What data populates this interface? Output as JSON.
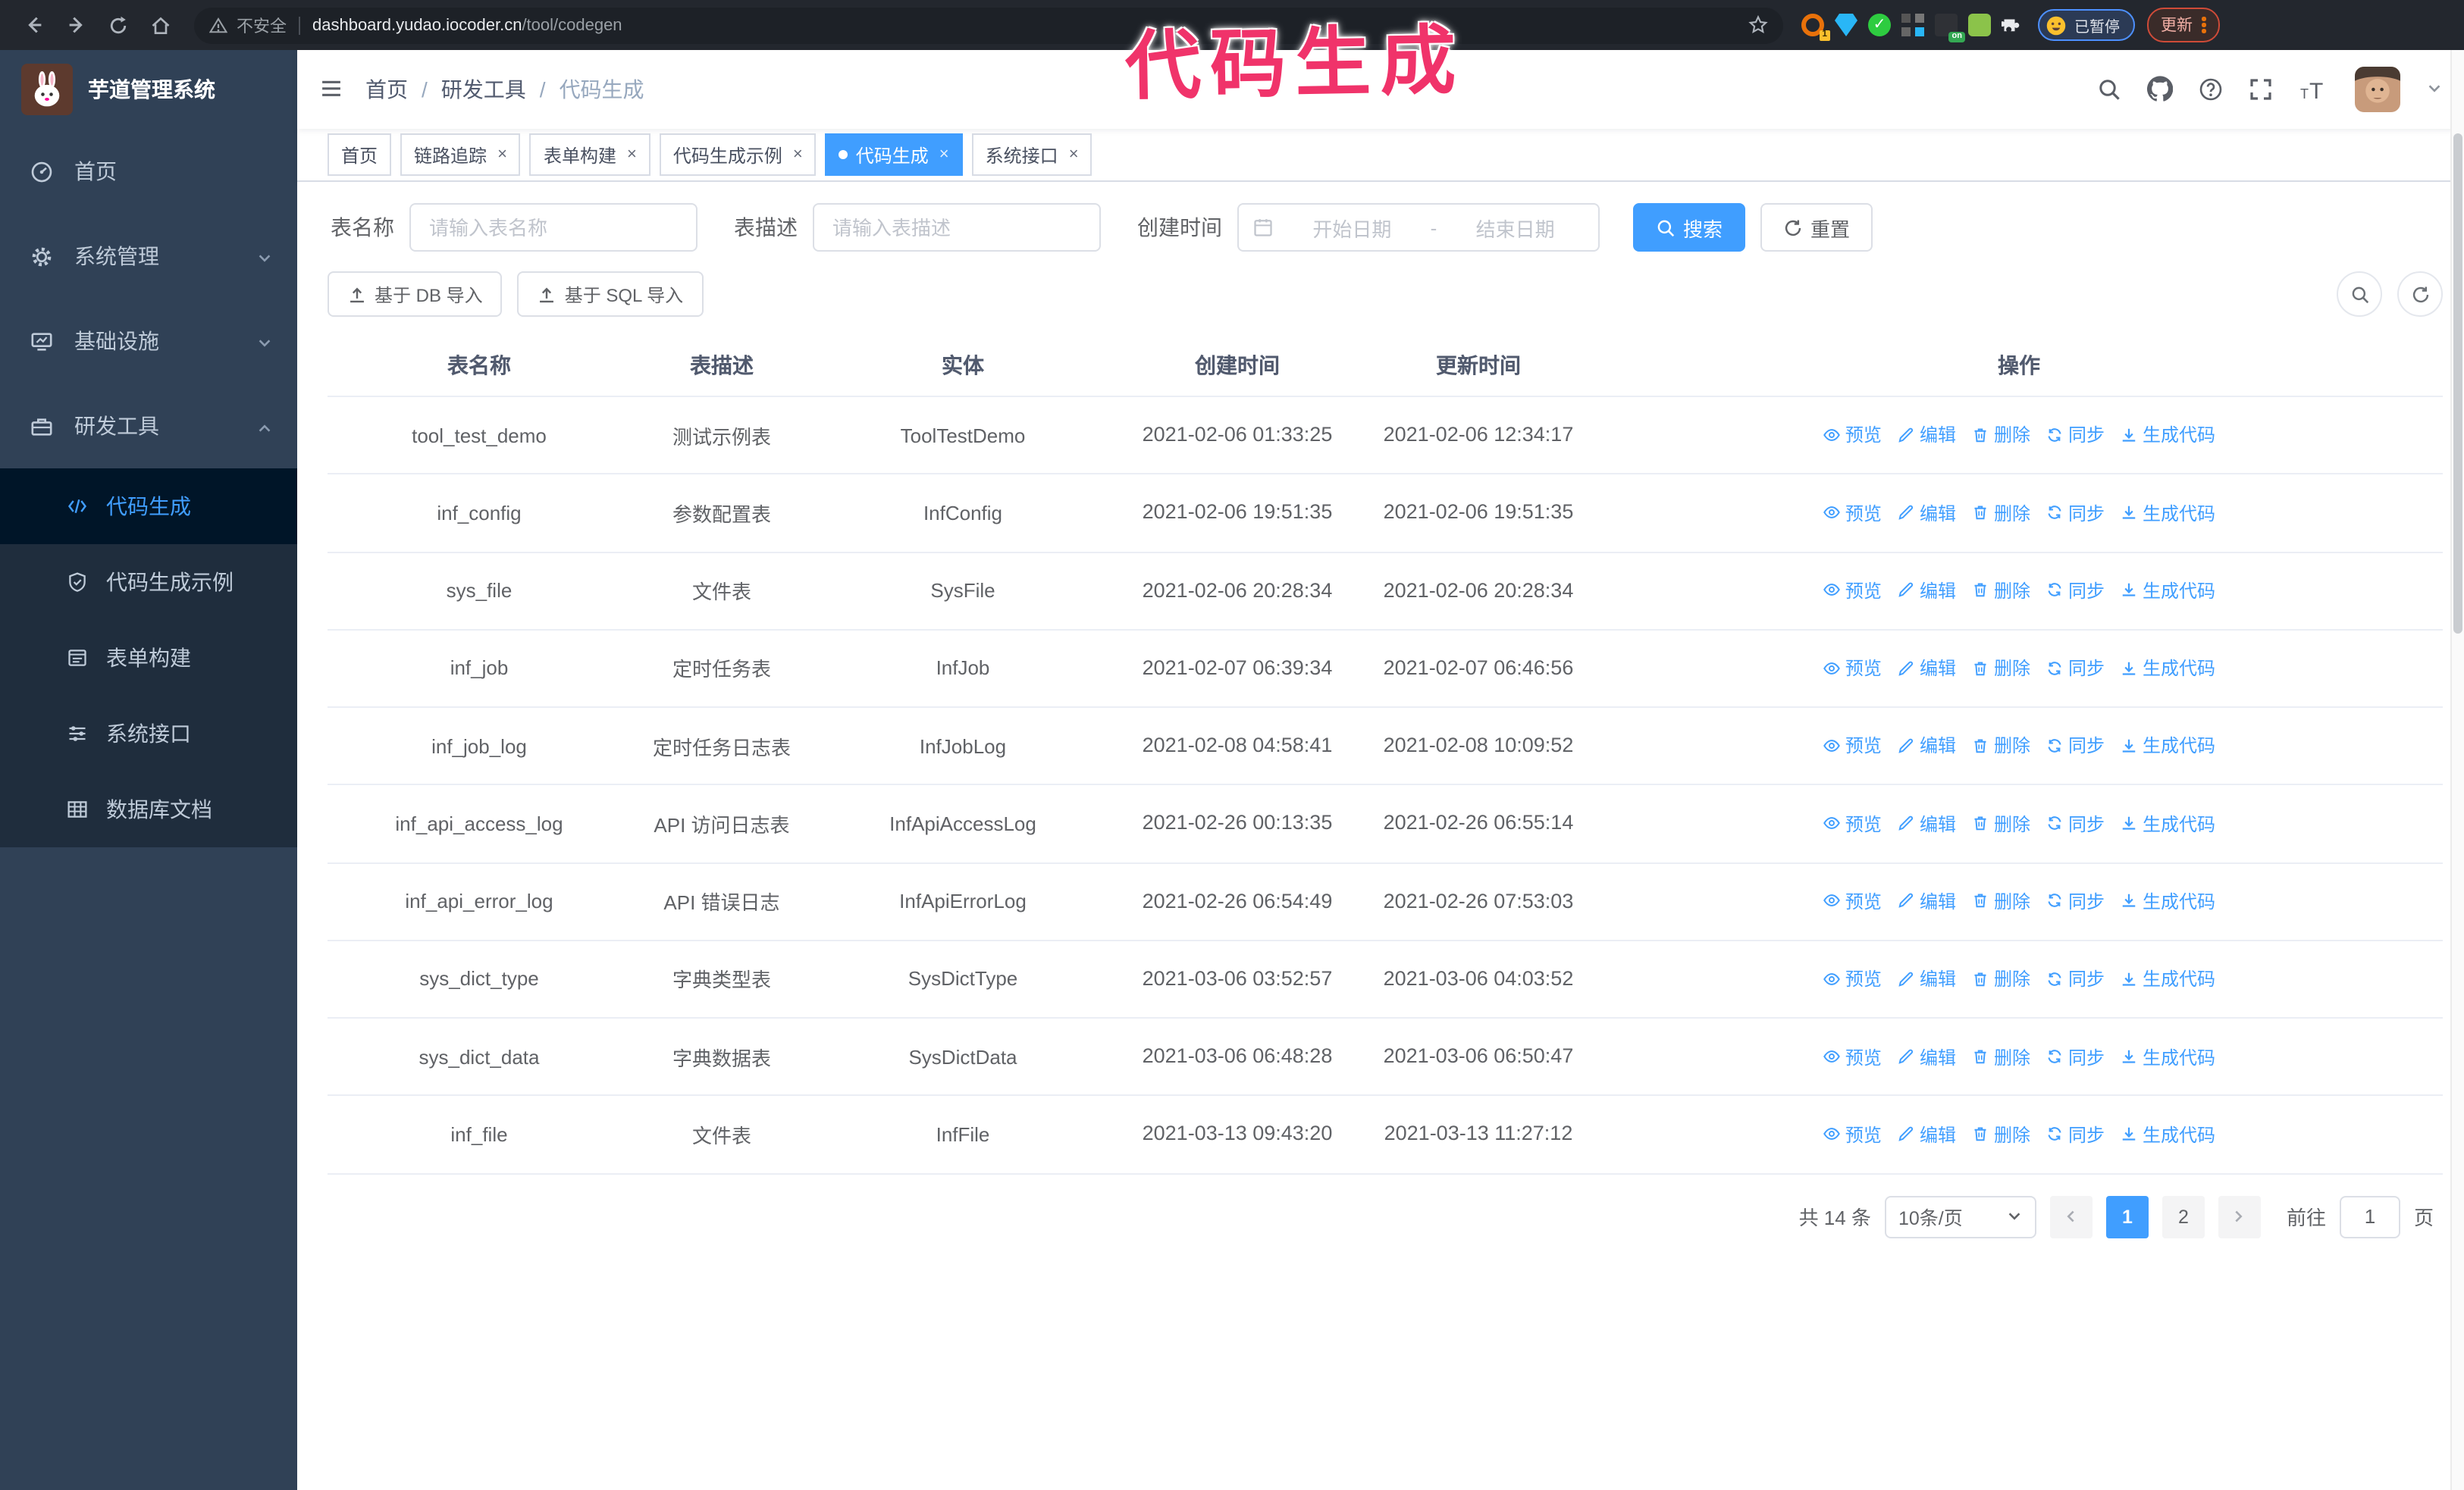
{
  "annotation": {
    "text": "代码生成"
  },
  "browser": {
    "insecure_label": "不安全",
    "url_host": "dashboard.yudao.iocoder.cn",
    "url_path": "/tool/codegen",
    "extension_badge": "1",
    "extension_on_badge": "on",
    "paused_label": "已暂停",
    "update_label": "更新"
  },
  "sidebar": {
    "app_title": "芋道管理系统",
    "items": [
      {
        "label": "首页",
        "icon": "i-dashboard",
        "arrow": ""
      },
      {
        "label": "系统管理",
        "icon": "i-gear",
        "arrow": "down"
      },
      {
        "label": "基础设施",
        "icon": "i-monitor",
        "arrow": "down"
      },
      {
        "label": "研发工具",
        "icon": "i-toolbox",
        "arrow": "up"
      }
    ],
    "submenu": [
      {
        "label": "代码生成",
        "icon": "i-code",
        "active": true
      },
      {
        "label": "代码生成示例",
        "icon": "i-shield",
        "active": false
      },
      {
        "label": "表单构建",
        "icon": "i-form",
        "active": false
      },
      {
        "label": "系统接口",
        "icon": "i-sliders",
        "active": false
      },
      {
        "label": "数据库文档",
        "icon": "i-dbdoc",
        "active": false
      }
    ]
  },
  "header": {
    "breadcrumb": [
      "首页",
      "研发工具",
      "代码生成"
    ]
  },
  "tabs": [
    {
      "label": "首页",
      "closable": false,
      "active": false
    },
    {
      "label": "链路追踪",
      "closable": true,
      "active": false
    },
    {
      "label": "表单构建",
      "closable": true,
      "active": false
    },
    {
      "label": "代码生成示例",
      "closable": true,
      "active": false
    },
    {
      "label": "代码生成",
      "closable": true,
      "active": true
    },
    {
      "label": "系统接口",
      "closable": true,
      "active": false
    }
  ],
  "search": {
    "table_name_label": "表名称",
    "table_name_placeholder": "请输入表名称",
    "table_desc_label": "表描述",
    "table_desc_placeholder": "请输入表描述",
    "create_time_label": "创建时间",
    "date_start_placeholder": "开始日期",
    "date_separator": "-",
    "date_end_placeholder": "结束日期",
    "search_button": "搜索",
    "reset_button": "重置"
  },
  "toolbar": {
    "import_db_button": "基于 DB 导入",
    "import_sql_button": "基于 SQL 导入"
  },
  "table": {
    "columns": [
      "表名称",
      "表描述",
      "实体",
      "创建时间",
      "更新时间",
      "操作"
    ],
    "actions": [
      "预览",
      "编辑",
      "删除",
      "同步",
      "生成代码"
    ],
    "rows": [
      {
        "name": "tool_test_demo",
        "desc": "测试示例表",
        "entity": "ToolTestDemo",
        "created": "2021-02-06 01:33:25",
        "updated": "2021-02-06 12:34:17"
      },
      {
        "name": "inf_config",
        "desc": "参数配置表",
        "entity": "InfConfig",
        "created": "2021-02-06 19:51:35",
        "updated": "2021-02-06 19:51:35"
      },
      {
        "name": "sys_file",
        "desc": "文件表",
        "entity": "SysFile",
        "created": "2021-02-06 20:28:34",
        "updated": "2021-02-06 20:28:34"
      },
      {
        "name": "inf_job",
        "desc": "定时任务表",
        "entity": "InfJob",
        "created": "2021-02-07 06:39:34",
        "updated": "2021-02-07 06:46:56"
      },
      {
        "name": "inf_job_log",
        "desc": "定时任务日志表",
        "entity": "InfJobLog",
        "created": "2021-02-08 04:58:41",
        "updated": "2021-02-08 10:09:52"
      },
      {
        "name": "inf_api_access_log",
        "desc": "API 访问日志表",
        "entity": "InfApiAccessLog",
        "created": "2021-02-26 00:13:35",
        "updated": "2021-02-26 06:55:14"
      },
      {
        "name": "inf_api_error_log",
        "desc": "API 错误日志",
        "entity": "InfApiErrorLog",
        "created": "2021-02-26 06:54:49",
        "updated": "2021-02-26 07:53:03"
      },
      {
        "name": "sys_dict_type",
        "desc": "字典类型表",
        "entity": "SysDictType",
        "created": "2021-03-06 03:52:57",
        "updated": "2021-03-06 04:03:52"
      },
      {
        "name": "sys_dict_data",
        "desc": "字典数据表",
        "entity": "SysDictData",
        "created": "2021-03-06 06:48:28",
        "updated": "2021-03-06 06:50:47"
      },
      {
        "name": "inf_file",
        "desc": "文件表",
        "entity": "InfFile",
        "created": "2021-03-13 09:43:20",
        "updated": "2021-03-13 11:27:12"
      }
    ]
  },
  "pagination": {
    "total_label": "共 14 条",
    "page_size": "10条/页",
    "pages": [
      "1",
      "2"
    ],
    "active_page": "1",
    "goto_label": "前往",
    "goto_value": "1",
    "page_suffix": "页"
  },
  "colors": {
    "accent_blue": "#409eff",
    "sidebar_bg": "#304156",
    "submenu_bg": "#1f2d3d",
    "active_item_bg": "#001528",
    "annotation_pink": "#f0336a",
    "browser_bar_bg": "#23272e"
  }
}
